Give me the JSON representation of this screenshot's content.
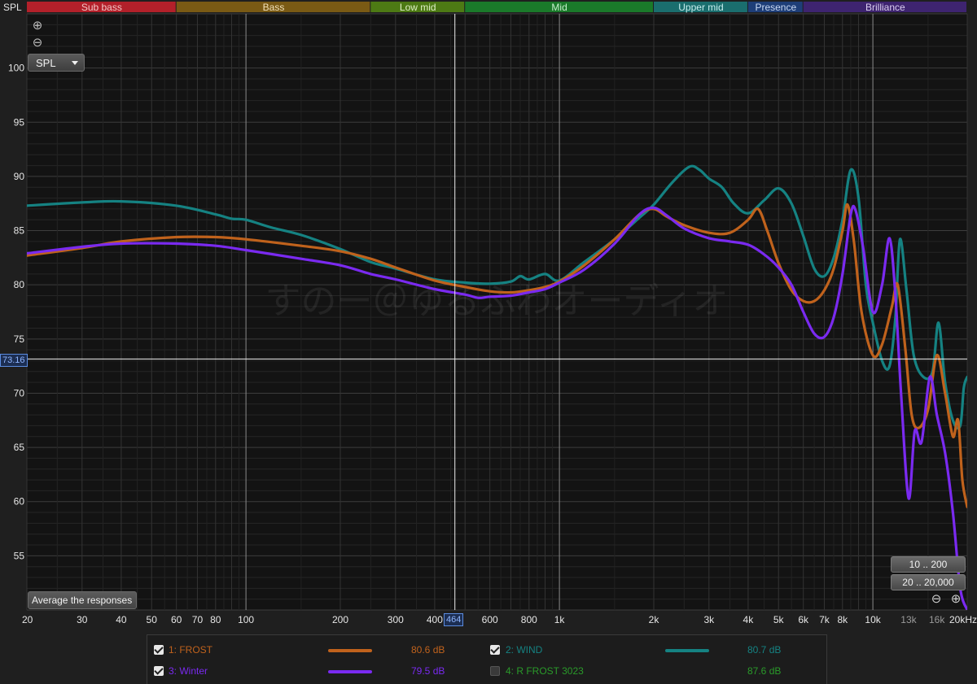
{
  "app": {
    "spl_label": "SPL",
    "spl_select": "SPL",
    "zoom_in": "⊕",
    "zoom_out": "⊖",
    "average_button": "Average the responses",
    "range_low": "10 .. 200",
    "range_full": "20 .. 20,000",
    "cursor_y_badge": "73.16",
    "cursor_x_badge": "464",
    "watermark": "すのー＠ゆるふわオーディオ"
  },
  "bands": [
    {
      "label": "Sub bass",
      "from": 20,
      "to": 60,
      "color": "#b3202a",
      "text": "#f2c6c6"
    },
    {
      "label": "Bass",
      "from": 60,
      "to": 250,
      "color": "#7a5a14",
      "text": "#f0e0b8"
    },
    {
      "label": "Low mid",
      "from": 250,
      "to": 500,
      "color": "#4d7a14",
      "text": "#dff0c6"
    },
    {
      "label": "Mid",
      "from": 500,
      "to": 2000,
      "color": "#1a7a2a",
      "text": "#c6f0cc"
    },
    {
      "label": "Upper mid",
      "from": 2000,
      "to": 4000,
      "color": "#1a6e6e",
      "text": "#c6eeee"
    },
    {
      "label": "Presence",
      "from": 4000,
      "to": 6000,
      "color": "#1e3e78",
      "text": "#c8d8f4"
    },
    {
      "label": "Brilliance",
      "from": 6000,
      "to": 20000,
      "color": "#3e2470",
      "text": "#dccff2"
    }
  ],
  "chart_data": {
    "type": "line",
    "x_scale": "log",
    "xlim": [
      20,
      20000
    ],
    "ylim": [
      50,
      105
    ],
    "y_ticks": [
      55,
      60,
      65,
      70,
      75,
      80,
      85,
      90,
      95,
      100
    ],
    "x_ticks": [
      {
        "v": 20,
        "label": "20"
      },
      {
        "v": 30,
        "label": "30"
      },
      {
        "v": 40,
        "label": "40"
      },
      {
        "v": 50,
        "label": "50"
      },
      {
        "v": 60,
        "label": "60"
      },
      {
        "v": 70,
        "label": "70"
      },
      {
        "v": 80,
        "label": "80"
      },
      {
        "v": 100,
        "label": "100"
      },
      {
        "v": 200,
        "label": "200"
      },
      {
        "v": 300,
        "label": "300"
      },
      {
        "v": 400,
        "label": "400"
      },
      {
        "v": 600,
        "label": "600"
      },
      {
        "v": 800,
        "label": "800"
      },
      {
        "v": 1000,
        "label": "1k"
      },
      {
        "v": 2000,
        "label": "2k"
      },
      {
        "v": 3000,
        "label": "3k"
      },
      {
        "v": 4000,
        "label": "4k"
      },
      {
        "v": 5000,
        "label": "5k"
      },
      {
        "v": 6000,
        "label": "6k"
      },
      {
        "v": 7000,
        "label": "7k"
      },
      {
        "v": 8000,
        "label": "8k"
      },
      {
        "v": 10000,
        "label": "10k"
      },
      {
        "v": 13000,
        "label": "13k",
        "dim": true
      },
      {
        "v": 16000,
        "label": "16k",
        "dim": true
      },
      {
        "v": 20000,
        "label": "20kHz"
      }
    ],
    "cursor": {
      "x": 464,
      "y": 73.16
    },
    "grid": true,
    "series": [
      {
        "name": "1: FROST",
        "color": "#c0621c",
        "checked": true,
        "avg": "80.6 dB",
        "points": [
          [
            20,
            82.7
          ],
          [
            30,
            83.4
          ],
          [
            40,
            84.0
          ],
          [
            60,
            84.4
          ],
          [
            80,
            84.4
          ],
          [
            100,
            84.2
          ],
          [
            150,
            83.6
          ],
          [
            200,
            83.1
          ],
          [
            250,
            82.4
          ],
          [
            300,
            81.6
          ],
          [
            400,
            80.4
          ],
          [
            500,
            79.8
          ],
          [
            600,
            79.4
          ],
          [
            700,
            79.3
          ],
          [
            800,
            79.5
          ],
          [
            900,
            79.8
          ],
          [
            1000,
            80.3
          ],
          [
            1200,
            81.8
          ],
          [
            1500,
            84.2
          ],
          [
            1800,
            86.5
          ],
          [
            2000,
            87.0
          ],
          [
            2200,
            86.3
          ],
          [
            2500,
            85.5
          ],
          [
            3000,
            84.8
          ],
          [
            3500,
            84.8
          ],
          [
            4000,
            86.0
          ],
          [
            4300,
            87.0
          ],
          [
            4600,
            85.0
          ],
          [
            5000,
            82.0
          ],
          [
            5500,
            79.5
          ],
          [
            6000,
            78.5
          ],
          [
            6500,
            78.5
          ],
          [
            7000,
            79.5
          ],
          [
            7500,
            81.5
          ],
          [
            8000,
            85.0
          ],
          [
            8300,
            87.4
          ],
          [
            8700,
            84.0
          ],
          [
            9200,
            77.5
          ],
          [
            10000,
            73.5
          ],
          [
            10700,
            74.5
          ],
          [
            11500,
            78.0
          ],
          [
            12000,
            80.0
          ],
          [
            12700,
            74.0
          ],
          [
            13300,
            68.0
          ],
          [
            14000,
            66.8
          ],
          [
            15000,
            68.5
          ],
          [
            16000,
            73.5
          ],
          [
            17000,
            70.0
          ],
          [
            18000,
            66.0
          ],
          [
            18700,
            67.5
          ],
          [
            19300,
            62.0
          ],
          [
            20000,
            59.5
          ]
        ]
      },
      {
        "name": "2: WIND",
        "color": "#158282",
        "checked": true,
        "avg": "80.7 dB",
        "points": [
          [
            20,
            87.3
          ],
          [
            30,
            87.6
          ],
          [
            40,
            87.7
          ],
          [
            60,
            87.3
          ],
          [
            80,
            86.5
          ],
          [
            90,
            86.1
          ],
          [
            100,
            86.0
          ],
          [
            120,
            85.3
          ],
          [
            150,
            84.6
          ],
          [
            200,
            83.3
          ],
          [
            250,
            82.1
          ],
          [
            300,
            81.5
          ],
          [
            400,
            80.5
          ],
          [
            500,
            80.2
          ],
          [
            600,
            80.1
          ],
          [
            700,
            80.3
          ],
          [
            750,
            80.8
          ],
          [
            800,
            80.5
          ],
          [
            900,
            81.0
          ],
          [
            1000,
            80.4
          ],
          [
            1200,
            82.1
          ],
          [
            1500,
            84.2
          ],
          [
            1800,
            86.2
          ],
          [
            2000,
            87.4
          ],
          [
            2300,
            89.5
          ],
          [
            2600,
            90.9
          ],
          [
            2800,
            90.6
          ],
          [
            3000,
            89.8
          ],
          [
            3300,
            89.0
          ],
          [
            3600,
            87.5
          ],
          [
            4000,
            86.6
          ],
          [
            4500,
            87.8
          ],
          [
            5000,
            88.9
          ],
          [
            5500,
            87.5
          ],
          [
            6000,
            84.5
          ],
          [
            6500,
            81.5
          ],
          [
            7000,
            80.8
          ],
          [
            7500,
            82.5
          ],
          [
            8000,
            86.0
          ],
          [
            8500,
            90.6
          ],
          [
            9000,
            88.0
          ],
          [
            9500,
            80.0
          ],
          [
            10000,
            76.5
          ],
          [
            10700,
            73.0
          ],
          [
            11300,
            72.5
          ],
          [
            11800,
            77.0
          ],
          [
            12200,
            84.2
          ],
          [
            12800,
            79.5
          ],
          [
            13500,
            73.5
          ],
          [
            14500,
            71.5
          ],
          [
            15500,
            72.0
          ],
          [
            16200,
            76.5
          ],
          [
            17000,
            71.0
          ],
          [
            18000,
            67.5
          ],
          [
            19000,
            67.0
          ],
          [
            19500,
            70.5
          ],
          [
            20000,
            71.5
          ]
        ]
      },
      {
        "name": "3: Winter",
        "color": "#7a2af0",
        "checked": true,
        "avg": "79.5 dB",
        "points": [
          [
            20,
            82.9
          ],
          [
            30,
            83.5
          ],
          [
            40,
            83.8
          ],
          [
            60,
            83.8
          ],
          [
            80,
            83.6
          ],
          [
            100,
            83.2
          ],
          [
            150,
            82.4
          ],
          [
            200,
            81.8
          ],
          [
            250,
            81.0
          ],
          [
            300,
            80.5
          ],
          [
            400,
            79.6
          ],
          [
            500,
            79.1
          ],
          [
            550,
            78.8
          ],
          [
            600,
            78.9
          ],
          [
            700,
            79.0
          ],
          [
            800,
            79.3
          ],
          [
            900,
            79.6
          ],
          [
            1000,
            80.2
          ],
          [
            1200,
            81.4
          ],
          [
            1500,
            83.8
          ],
          [
            1800,
            86.5
          ],
          [
            2000,
            87.1
          ],
          [
            2200,
            86.4
          ],
          [
            2500,
            85.2
          ],
          [
            3000,
            84.3
          ],
          [
            3500,
            84.0
          ],
          [
            4000,
            83.7
          ],
          [
            4500,
            82.8
          ],
          [
            5000,
            81.6
          ],
          [
            5500,
            80.0
          ],
          [
            6000,
            77.5
          ],
          [
            6500,
            75.5
          ],
          [
            7000,
            75.2
          ],
          [
            7500,
            77.0
          ],
          [
            8000,
            81.0
          ],
          [
            8500,
            86.5
          ],
          [
            8800,
            86.9
          ],
          [
            9300,
            83.5
          ],
          [
            10000,
            77.5
          ],
          [
            10700,
            80.0
          ],
          [
            11300,
            84.3
          ],
          [
            11800,
            79.0
          ],
          [
            12300,
            70.0
          ],
          [
            13000,
            60.3
          ],
          [
            13600,
            66.5
          ],
          [
            14300,
            65.5
          ],
          [
            15200,
            71.5
          ],
          [
            16000,
            68.0
          ],
          [
            17000,
            64.5
          ],
          [
            18000,
            59.0
          ],
          [
            19000,
            52.0
          ],
          [
            20000,
            50.0
          ]
        ]
      }
    ]
  },
  "legend": [
    {
      "name": "1: FROST",
      "color": "#c0621c",
      "value": "80.6 dB",
      "checked": true,
      "swatch": true
    },
    {
      "name": "2: WIND",
      "color": "#158282",
      "value": "80.7 dB",
      "checked": true,
      "swatch": true
    },
    {
      "name": "3: Winter",
      "color": "#7a2af0",
      "value": "79.5 dB",
      "checked": true,
      "swatch": true
    },
    {
      "name": "4: R FROST 3023",
      "color": "#2a9a2a",
      "value": "87.6 dB",
      "checked": false,
      "swatch": false
    }
  ]
}
